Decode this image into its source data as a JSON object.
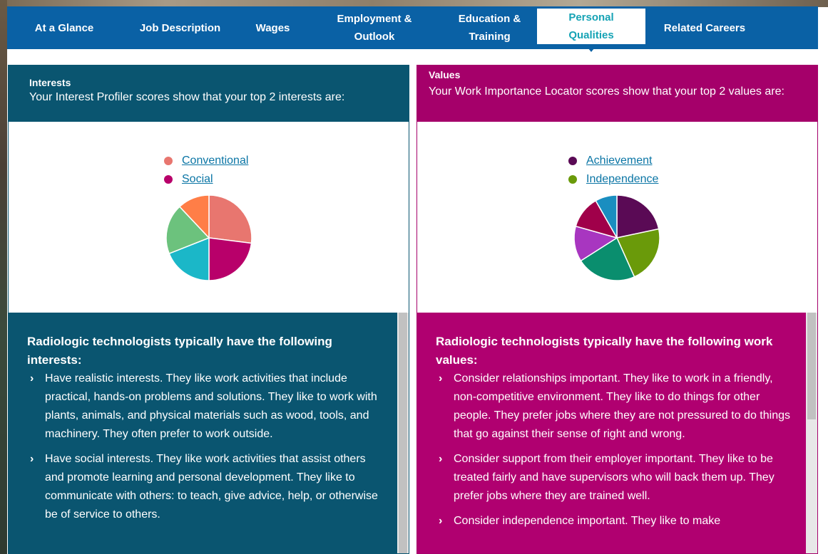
{
  "nav": {
    "items": [
      {
        "label": "At a Glance"
      },
      {
        "label": "Job Description"
      },
      {
        "label": "Wages"
      },
      {
        "label": "Employment &\nOutlook"
      },
      {
        "label": "Education &\nTraining"
      },
      {
        "label": "Personal\nQualities"
      },
      {
        "label": "Related Careers"
      }
    ],
    "active": "Personal Qualities"
  },
  "interests": {
    "title": "Interests",
    "subtitle": "Your Interest Profiler scores show that your top 2 interests are:",
    "legend": [
      {
        "label": "Conventional",
        "color": "#e8766f"
      },
      {
        "label": "Social",
        "color": "#b8006a"
      }
    ],
    "chart_data": {
      "type": "pie",
      "slices": [
        {
          "value": 27,
          "color": "#e8766f"
        },
        {
          "value": 23,
          "color": "#b8006a"
        },
        {
          "value": 19,
          "color": "#1bb7c8"
        },
        {
          "value": 19,
          "color": "#6cc27d"
        },
        {
          "value": 12,
          "color": "#ff7e47"
        }
      ]
    },
    "heading": "Radiologic technologists typically have the following interests:",
    "bullets": [
      "Have realistic interests. They like work activities that include practical, hands-on problems and solutions. They like to work with plants, animals, and physical materials such as wood, tools, and machinery. They often prefer to work outside.",
      "Have social interests. They like work activities that assist others and promote learning and personal development. They like to communicate with others: to teach, give advice, help, or otherwise be of service to others."
    ]
  },
  "values": {
    "title": "Values",
    "subtitle": "Your Work Importance Locator scores show that your top 2 values are:",
    "legend": [
      {
        "label": "Achievement",
        "color": "#5a0a55"
      },
      {
        "label": "Independence",
        "color": "#6a9a0a"
      }
    ],
    "chart_data": {
      "type": "pie",
      "slices": [
        {
          "value": 21,
          "color": "#5a0a55"
        },
        {
          "value": 21,
          "color": "#6a9a0a"
        },
        {
          "value": 22,
          "color": "#0a8e6e"
        },
        {
          "value": 13,
          "color": "#a836c0"
        },
        {
          "value": 12,
          "color": "#a0004a"
        },
        {
          "value": 8,
          "color": "#1a8ec0"
        }
      ]
    },
    "heading": "Radiologic technologists typically have the following work values:",
    "bullets": [
      "Consider relationships important. They like to work in a friendly, non-competitive environment. They like to do things for other people. They prefer jobs where they are not pressured to do things that go against their sense of right and wrong.",
      "Consider support from their employer important. They like to be treated fairly and have supervisors who will back them up. They prefer jobs where they are trained well.",
      "Consider independence important. They like to make"
    ]
  }
}
